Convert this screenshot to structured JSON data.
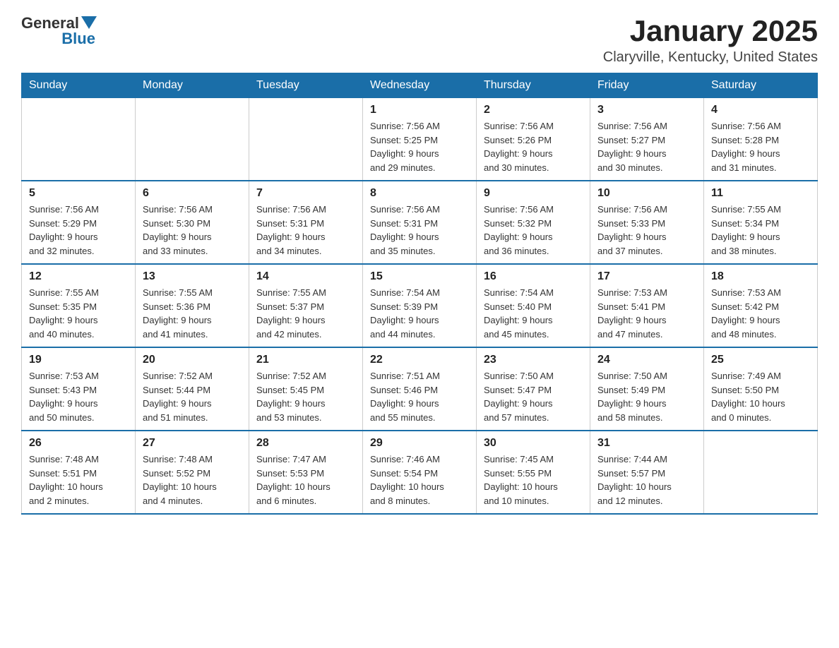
{
  "header": {
    "logo": {
      "general": "General",
      "blue": "Blue"
    },
    "title": "January 2025",
    "location": "Claryville, Kentucky, United States"
  },
  "weekdays": [
    "Sunday",
    "Monday",
    "Tuesday",
    "Wednesday",
    "Thursday",
    "Friday",
    "Saturday"
  ],
  "weeks": [
    [
      {
        "day": "",
        "info": ""
      },
      {
        "day": "",
        "info": ""
      },
      {
        "day": "",
        "info": ""
      },
      {
        "day": "1",
        "info": "Sunrise: 7:56 AM\nSunset: 5:25 PM\nDaylight: 9 hours\nand 29 minutes."
      },
      {
        "day": "2",
        "info": "Sunrise: 7:56 AM\nSunset: 5:26 PM\nDaylight: 9 hours\nand 30 minutes."
      },
      {
        "day": "3",
        "info": "Sunrise: 7:56 AM\nSunset: 5:27 PM\nDaylight: 9 hours\nand 30 minutes."
      },
      {
        "day": "4",
        "info": "Sunrise: 7:56 AM\nSunset: 5:28 PM\nDaylight: 9 hours\nand 31 minutes."
      }
    ],
    [
      {
        "day": "5",
        "info": "Sunrise: 7:56 AM\nSunset: 5:29 PM\nDaylight: 9 hours\nand 32 minutes."
      },
      {
        "day": "6",
        "info": "Sunrise: 7:56 AM\nSunset: 5:30 PM\nDaylight: 9 hours\nand 33 minutes."
      },
      {
        "day": "7",
        "info": "Sunrise: 7:56 AM\nSunset: 5:31 PM\nDaylight: 9 hours\nand 34 minutes."
      },
      {
        "day": "8",
        "info": "Sunrise: 7:56 AM\nSunset: 5:31 PM\nDaylight: 9 hours\nand 35 minutes."
      },
      {
        "day": "9",
        "info": "Sunrise: 7:56 AM\nSunset: 5:32 PM\nDaylight: 9 hours\nand 36 minutes."
      },
      {
        "day": "10",
        "info": "Sunrise: 7:56 AM\nSunset: 5:33 PM\nDaylight: 9 hours\nand 37 minutes."
      },
      {
        "day": "11",
        "info": "Sunrise: 7:55 AM\nSunset: 5:34 PM\nDaylight: 9 hours\nand 38 minutes."
      }
    ],
    [
      {
        "day": "12",
        "info": "Sunrise: 7:55 AM\nSunset: 5:35 PM\nDaylight: 9 hours\nand 40 minutes."
      },
      {
        "day": "13",
        "info": "Sunrise: 7:55 AM\nSunset: 5:36 PM\nDaylight: 9 hours\nand 41 minutes."
      },
      {
        "day": "14",
        "info": "Sunrise: 7:55 AM\nSunset: 5:37 PM\nDaylight: 9 hours\nand 42 minutes."
      },
      {
        "day": "15",
        "info": "Sunrise: 7:54 AM\nSunset: 5:39 PM\nDaylight: 9 hours\nand 44 minutes."
      },
      {
        "day": "16",
        "info": "Sunrise: 7:54 AM\nSunset: 5:40 PM\nDaylight: 9 hours\nand 45 minutes."
      },
      {
        "day": "17",
        "info": "Sunrise: 7:53 AM\nSunset: 5:41 PM\nDaylight: 9 hours\nand 47 minutes."
      },
      {
        "day": "18",
        "info": "Sunrise: 7:53 AM\nSunset: 5:42 PM\nDaylight: 9 hours\nand 48 minutes."
      }
    ],
    [
      {
        "day": "19",
        "info": "Sunrise: 7:53 AM\nSunset: 5:43 PM\nDaylight: 9 hours\nand 50 minutes."
      },
      {
        "day": "20",
        "info": "Sunrise: 7:52 AM\nSunset: 5:44 PM\nDaylight: 9 hours\nand 51 minutes."
      },
      {
        "day": "21",
        "info": "Sunrise: 7:52 AM\nSunset: 5:45 PM\nDaylight: 9 hours\nand 53 minutes."
      },
      {
        "day": "22",
        "info": "Sunrise: 7:51 AM\nSunset: 5:46 PM\nDaylight: 9 hours\nand 55 minutes."
      },
      {
        "day": "23",
        "info": "Sunrise: 7:50 AM\nSunset: 5:47 PM\nDaylight: 9 hours\nand 57 minutes."
      },
      {
        "day": "24",
        "info": "Sunrise: 7:50 AM\nSunset: 5:49 PM\nDaylight: 9 hours\nand 58 minutes."
      },
      {
        "day": "25",
        "info": "Sunrise: 7:49 AM\nSunset: 5:50 PM\nDaylight: 10 hours\nand 0 minutes."
      }
    ],
    [
      {
        "day": "26",
        "info": "Sunrise: 7:48 AM\nSunset: 5:51 PM\nDaylight: 10 hours\nand 2 minutes."
      },
      {
        "day": "27",
        "info": "Sunrise: 7:48 AM\nSunset: 5:52 PM\nDaylight: 10 hours\nand 4 minutes."
      },
      {
        "day": "28",
        "info": "Sunrise: 7:47 AM\nSunset: 5:53 PM\nDaylight: 10 hours\nand 6 minutes."
      },
      {
        "day": "29",
        "info": "Sunrise: 7:46 AM\nSunset: 5:54 PM\nDaylight: 10 hours\nand 8 minutes."
      },
      {
        "day": "30",
        "info": "Sunrise: 7:45 AM\nSunset: 5:55 PM\nDaylight: 10 hours\nand 10 minutes."
      },
      {
        "day": "31",
        "info": "Sunrise: 7:44 AM\nSunset: 5:57 PM\nDaylight: 10 hours\nand 12 minutes."
      },
      {
        "day": "",
        "info": ""
      }
    ]
  ]
}
